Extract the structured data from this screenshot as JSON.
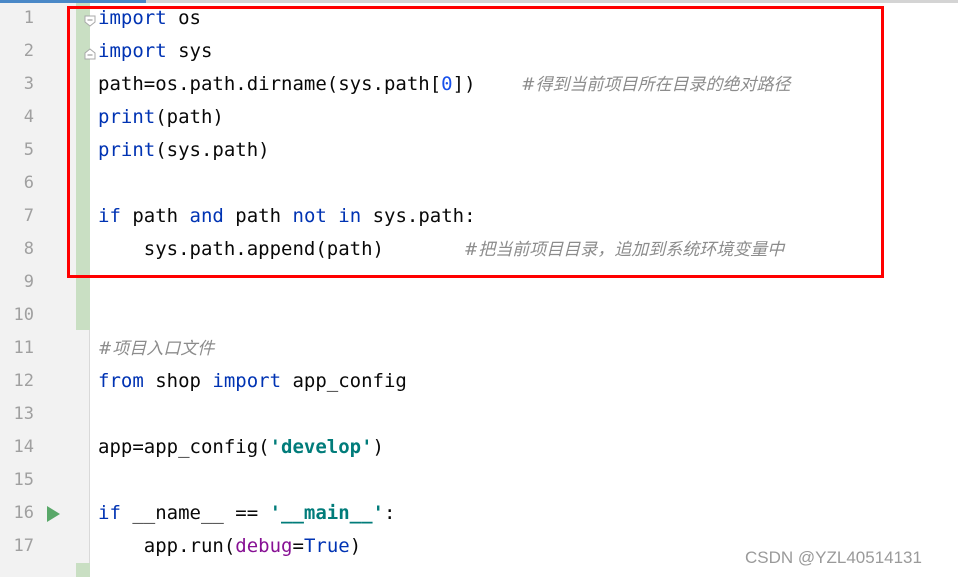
{
  "editor": {
    "line_numbers": [
      "1",
      "2",
      "3",
      "4",
      "5",
      "6",
      "7",
      "8",
      "9",
      "10",
      "11",
      "12",
      "13",
      "14",
      "15",
      "16",
      "17"
    ],
    "lines": [
      {
        "n": 1,
        "tokens": [
          {
            "t": "import",
            "c": "kw"
          },
          {
            "t": " os",
            "c": ""
          }
        ]
      },
      {
        "n": 2,
        "tokens": [
          {
            "t": "import",
            "c": "kw"
          },
          {
            "t": " sys",
            "c": ""
          }
        ]
      },
      {
        "n": 3,
        "tokens": [
          {
            "t": "path=os.path.dirname(sys.path[",
            "c": ""
          },
          {
            "t": "0",
            "c": "num"
          },
          {
            "t": "])    ",
            "c": ""
          },
          {
            "t": "#得到当前项目所在目录的绝对路径",
            "c": "cmt"
          }
        ]
      },
      {
        "n": 4,
        "tokens": [
          {
            "t": "print",
            "c": "kw"
          },
          {
            "t": "(path)",
            "c": ""
          }
        ]
      },
      {
        "n": 5,
        "tokens": [
          {
            "t": "print",
            "c": "kw"
          },
          {
            "t": "(sys.path)",
            "c": ""
          }
        ]
      },
      {
        "n": 6,
        "tokens": []
      },
      {
        "n": 7,
        "tokens": [
          {
            "t": "if",
            "c": "kw"
          },
          {
            "t": " path ",
            "c": ""
          },
          {
            "t": "and",
            "c": "kw"
          },
          {
            "t": " path ",
            "c": ""
          },
          {
            "t": "not in",
            "c": "kw"
          },
          {
            "t": " sys.path:",
            "c": ""
          }
        ]
      },
      {
        "n": 8,
        "tokens": [
          {
            "t": "    sys.path.append(path)       ",
            "c": ""
          },
          {
            "t": "#把当前项目目录，追加到系统环境变量中",
            "c": "cmt"
          }
        ]
      },
      {
        "n": 9,
        "tokens": []
      },
      {
        "n": 10,
        "tokens": []
      },
      {
        "n": 11,
        "tokens": [
          {
            "t": "#项目入口文件",
            "c": "cmt"
          }
        ]
      },
      {
        "n": 12,
        "tokens": [
          {
            "t": "from",
            "c": "kw"
          },
          {
            "t": " shop ",
            "c": ""
          },
          {
            "t": "import",
            "c": "kw"
          },
          {
            "t": " app_config",
            "c": ""
          }
        ]
      },
      {
        "n": 13,
        "tokens": []
      },
      {
        "n": 14,
        "tokens": [
          {
            "t": "app=app_config(",
            "c": ""
          },
          {
            "t": "'develop'",
            "c": "str"
          },
          {
            "t": ")",
            "c": ""
          }
        ]
      },
      {
        "n": 15,
        "tokens": []
      },
      {
        "n": 16,
        "tokens": [
          {
            "t": "if",
            "c": "kw"
          },
          {
            "t": " __name__ == ",
            "c": ""
          },
          {
            "t": "'__main__'",
            "c": "str"
          },
          {
            "t": ":",
            "c": ""
          }
        ]
      },
      {
        "n": 17,
        "tokens": [
          {
            "t": "    app.run(",
            "c": ""
          },
          {
            "t": "debug",
            "c": "param"
          },
          {
            "t": "=",
            "c": ""
          },
          {
            "t": "True",
            "c": "kw"
          },
          {
            "t": ")",
            "c": ""
          }
        ]
      }
    ],
    "run_line": 16,
    "fold_lines": [
      1,
      2
    ]
  },
  "annotation": {
    "color": "#ff0000"
  },
  "watermark": "CSDN @YZL40514131"
}
